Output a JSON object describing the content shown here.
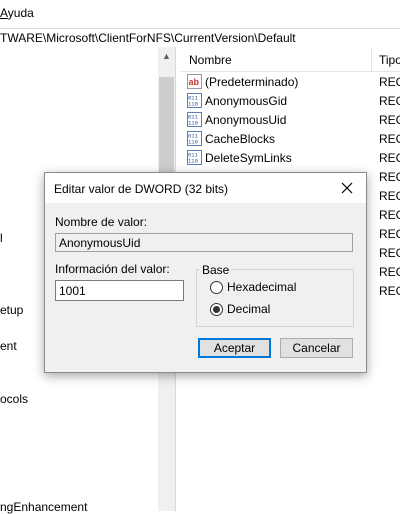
{
  "menubar": {
    "help": "Ayuda"
  },
  "address": {
    "path": "TWARE\\Microsoft\\ClientForNFS\\CurrentVersion\\Default"
  },
  "tree": {
    "items": [
      "l",
      "etup",
      "ent",
      "ocols",
      "ngEnhancement"
    ]
  },
  "list": {
    "col_name": "Nombre",
    "col_type": "Tipo",
    "rows": [
      {
        "name": "(Predeterminado)",
        "type": "REG",
        "icon": "string-value-icon"
      },
      {
        "name": "AnonymousGid",
        "type": "REG",
        "icon": "binary-value-icon"
      },
      {
        "name": "AnonymousUid",
        "type": "REG",
        "icon": "binary-value-icon"
      },
      {
        "name": "CacheBlocks",
        "type": "REG",
        "icon": "binary-value-icon"
      },
      {
        "name": "DeleteSymLinks",
        "type": "REG",
        "icon": "binary-value-icon"
      }
    ],
    "extra_types": [
      "REG",
      "REG",
      "REG",
      "REG",
      "REG",
      "REG",
      "REG"
    ]
  },
  "dialog": {
    "title": "Editar valor de DWORD (32 bits)",
    "name_label": "Nombre de valor:",
    "name_value": "AnonymousUid",
    "data_label": "Información del valor:",
    "data_value": "1001",
    "base_label": "Base",
    "hex_label": "Hexadecimal",
    "dec_label": "Decimal",
    "selected_base": "Decimal",
    "ok_label": "Aceptar",
    "cancel_label": "Cancelar"
  }
}
